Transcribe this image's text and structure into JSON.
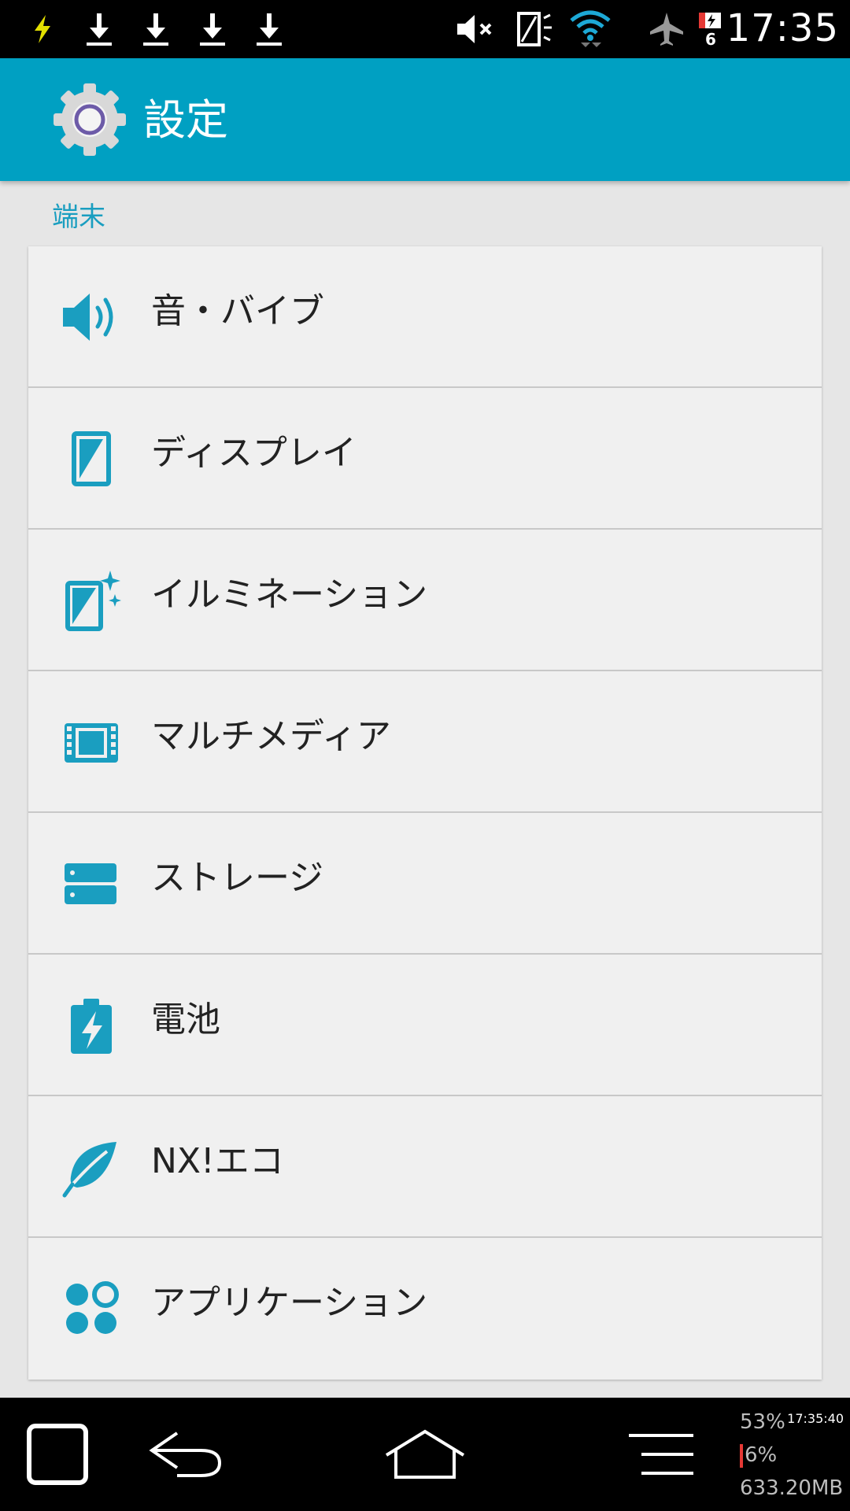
{
  "status_bar": {
    "time": "17:35",
    "battery_level": "6",
    "icons": [
      "charging-bolt-icon",
      "download-icon",
      "download-icon",
      "download-icon",
      "download-icon",
      "mute-icon",
      "display-icon",
      "wifi-icon",
      "airplane-icon",
      "battery-icon"
    ]
  },
  "app_bar": {
    "title": "設定",
    "icon": "settings-gear-icon",
    "background_color": "#00a0c2"
  },
  "section": {
    "header": "端末",
    "accent_color": "#1a9ec0"
  },
  "items": [
    {
      "label": "音・バイブ",
      "icon": "sound-icon"
    },
    {
      "label": "ディスプレイ",
      "icon": "display-icon"
    },
    {
      "label": "イルミネーション",
      "icon": "illumination-icon"
    },
    {
      "label": "マルチメディア",
      "icon": "multimedia-film-icon"
    },
    {
      "label": "ストレージ",
      "icon": "storage-icon"
    },
    {
      "label": "電池",
      "icon": "battery-charge-icon"
    },
    {
      "label": "NX!エコ",
      "icon": "eco-leaf-icon"
    },
    {
      "label": "アプリケーション",
      "icon": "apps-icon"
    }
  ],
  "nav_bar": {
    "buttons": [
      "recents-icon",
      "back-icon",
      "home-icon",
      "menu-icon"
    ]
  },
  "monitor": {
    "time": "17:35:40",
    "cpu": "53%",
    "usage": "6%",
    "memory": "633.20MB"
  }
}
